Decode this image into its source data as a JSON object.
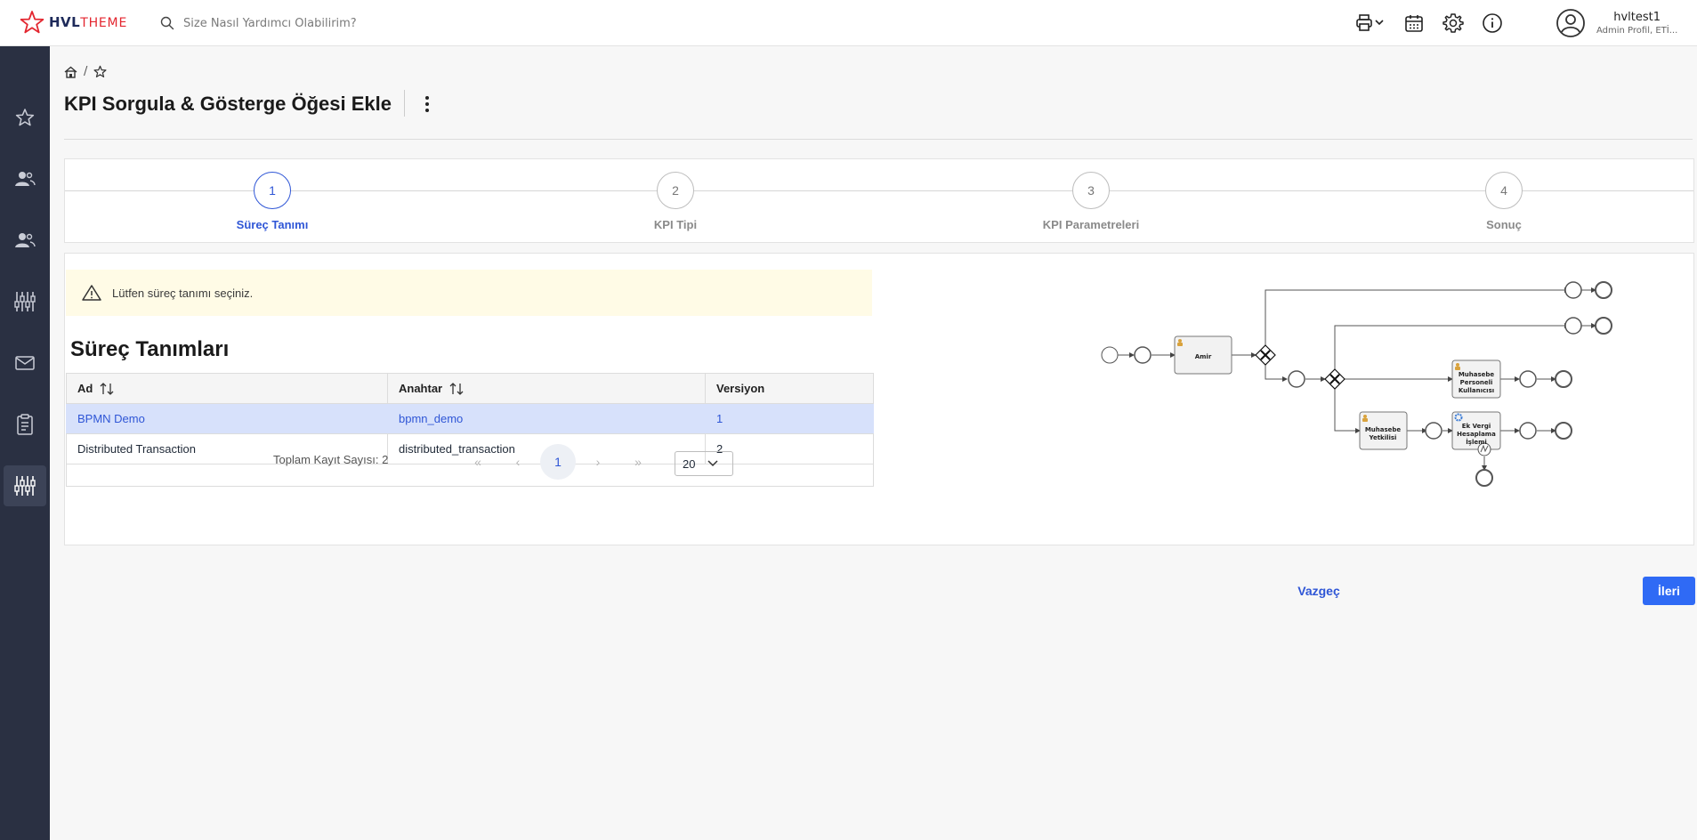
{
  "app": {
    "logo_main": "HVL",
    "logo_sub": "THEME"
  },
  "header": {
    "search_placeholder": "Size Nasıl Yardımcı Olabilirim?",
    "icons": [
      "printer-icon",
      "calendar-icon",
      "gear-icon",
      "info-icon"
    ],
    "user": {
      "name": "hvltest1",
      "role": "Admin Profil, ETİ..."
    }
  },
  "sidebar": {
    "items": [
      "star-icon",
      "users-icon",
      "user-group-icon",
      "sliders-icon",
      "mail-icon",
      "clipboard-icon",
      "sliders-active-icon"
    ]
  },
  "page": {
    "breadcrumb_sep": "/",
    "title": "KPI Sorgula & Gösterge Öğesi Ekle"
  },
  "stepper": {
    "steps": [
      {
        "num": "1",
        "label": "Süreç Tanımı",
        "active": true
      },
      {
        "num": "2",
        "label": "KPI Tipi",
        "active": false
      },
      {
        "num": "3",
        "label": "KPI Parametreleri",
        "active": false
      },
      {
        "num": "4",
        "label": "Sonuç",
        "active": false
      }
    ]
  },
  "alert": {
    "text": "Lütfen süreç tanımı seçiniz."
  },
  "section": {
    "title": "Süreç Tanımları"
  },
  "table": {
    "headers": {
      "ad": "Ad",
      "anahtar": "Anahtar",
      "versiyon": "Versiyon"
    },
    "rows": [
      {
        "ad": "BPMN Demo",
        "anahtar": "bpmn_demo",
        "versiyon": "1"
      },
      {
        "ad": "Distributed Transaction",
        "anahtar": "distributed_transaction",
        "versiyon": "2"
      }
    ]
  },
  "pager": {
    "total": "Toplam Kayıt Sayısı: 2",
    "first": "«",
    "prev": "‹",
    "current": "1",
    "next": "›",
    "last": "»",
    "page_size": "20"
  },
  "diagram": {
    "task_amir": "Amir",
    "task_personel": [
      "Muhasebe",
      "Personeli",
      "Kullanıcısı"
    ],
    "task_yetkili": [
      "Muhasebe",
      "Yetkilisi"
    ],
    "task_vergi": [
      "Ek Vergi",
      "Hesaplama",
      "İşlemi"
    ]
  },
  "actions": {
    "cancel": "Vazgeç",
    "next": "İleri"
  }
}
